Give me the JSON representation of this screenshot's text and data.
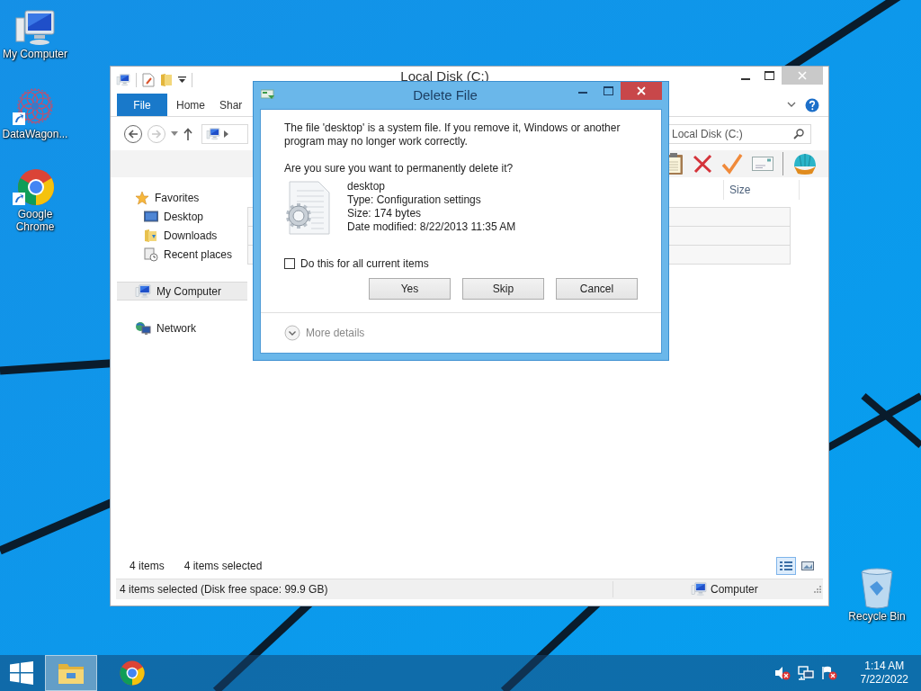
{
  "desktop": {
    "icons": [
      {
        "label": "My Computer",
        "kind": "computer"
      },
      {
        "label": "DataWagon...",
        "kind": "rosette"
      },
      {
        "label": "Google Chrome",
        "kind": "chrome"
      }
    ],
    "recycle_bin": {
      "label": "Recycle Bin"
    }
  },
  "explorer": {
    "title": "Local Disk (C:)",
    "ribbon_tabs": [
      {
        "label": "File",
        "selected": true
      },
      {
        "label": "Home",
        "selected": false
      },
      {
        "label": "Shar",
        "selected": false
      }
    ],
    "search": {
      "placeholder": "Local Disk (C:)"
    },
    "nav": [
      {
        "label": "Favorites",
        "kind": "star",
        "selected": false,
        "children": [
          {
            "label": "Desktop",
            "kind": "desktop",
            "selected": false
          },
          {
            "label": "Downloads",
            "kind": "downloads",
            "selected": false
          },
          {
            "label": "Recent places",
            "kind": "recent",
            "selected": false
          }
        ]
      },
      {
        "label": "My Computer",
        "kind": "computer",
        "selected": true
      },
      {
        "label": "Network",
        "kind": "network",
        "selected": false
      }
    ],
    "columns": [
      "Size"
    ],
    "item_count": "4 items",
    "selection_count": "4 items selected",
    "view_buttons": [
      {
        "kind": "details",
        "selected": true
      },
      {
        "kind": "tiles",
        "selected": false
      }
    ],
    "status_bar": {
      "text": "4 items selected (Disk free space: 99.9 GB)",
      "location": "Computer"
    }
  },
  "dialog": {
    "title": "Delete File",
    "message": "The file 'desktop' is a system file. If you remove it, Windows or another program may no longer work correctly.",
    "question": "Are you sure you want to permanently delete it?",
    "file": {
      "name": "desktop",
      "details": [
        "Type: Configuration settings",
        "Size: 174 bytes",
        "Date modified: 8/22/2013 11:35 AM"
      ]
    },
    "apply_all": {
      "label": "Do this for all current items",
      "checked": false
    },
    "buttons": [
      "Yes",
      "Skip",
      "Cancel"
    ],
    "more_details": "More details"
  },
  "taskbar": {
    "apps": [
      {
        "kind": "explorer",
        "selected": true
      },
      {
        "kind": "chrome",
        "selected": false
      }
    ],
    "clock": {
      "time": "1:14 AM",
      "date": "7/22/2022"
    }
  }
}
